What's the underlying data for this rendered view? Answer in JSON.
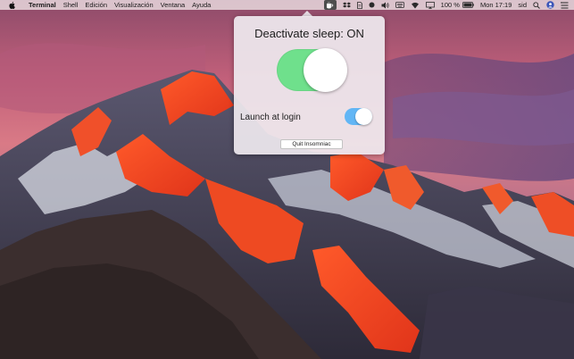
{
  "menubar": {
    "app_name": "Terminal",
    "menus": [
      "Shell",
      "Edición",
      "Visualización",
      "Ventana",
      "Ayuda"
    ],
    "status": {
      "battery": "100 %",
      "clock": "Mon 17:19",
      "user": "sid"
    },
    "status_icons": [
      "insomniac-cup-icon",
      "dropbox-icon",
      "document-icon",
      "record-icon",
      "volume-icon",
      "keyboard-icon",
      "wifi-icon",
      "airplay-icon",
      "battery-icon",
      "search-icon",
      "user-avatar-icon",
      "notification-center-icon"
    ]
  },
  "popover": {
    "title": "Deactivate sleep: ON",
    "sleep_toggle_state": "on",
    "launch_at_login_label": "Launch at login",
    "launch_at_login_state": "on",
    "quit_button_label": "Quit Insomniac"
  },
  "colors": {
    "toggle_on_green": "#6fe08c",
    "toggle_on_blue": "#62b6f5",
    "menubar_bg": "#ecdee2"
  }
}
